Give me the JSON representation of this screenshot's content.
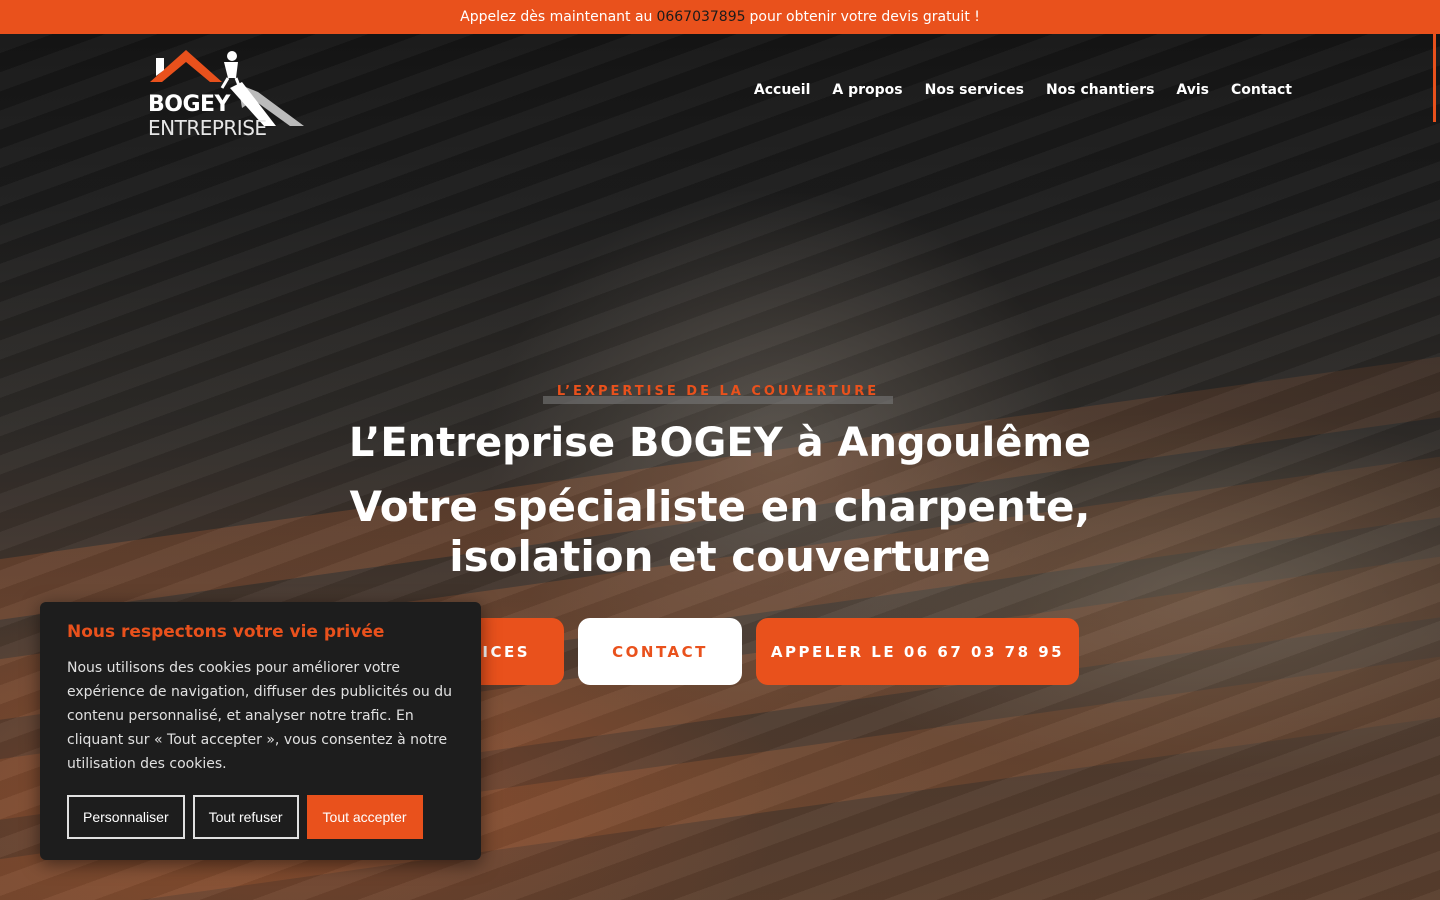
{
  "topbar": {
    "prefix": "Appelez dès maintenant au",
    "phone": "0667037895",
    "suffix": "pour obtenir votre devis gratuit !"
  },
  "logo": {
    "line1": "BOGEY",
    "line2": "ENTREPRISE"
  },
  "nav": {
    "items": [
      {
        "label": "Accueil"
      },
      {
        "label": "A propos"
      },
      {
        "label": "Nos services"
      },
      {
        "label": "Nos chantiers"
      },
      {
        "label": "Avis"
      },
      {
        "label": "Contact"
      }
    ]
  },
  "hero": {
    "eyebrow": "L’EXPERTISE DE LA COUVERTURE",
    "title": "L’Entreprise BOGEY à Angoulême",
    "subtitle": "Votre spécialiste en charpente, isolation et couverture",
    "buttons": {
      "services": "VICES",
      "contact": "CONTACT",
      "call": "APPELER LE 06 67 03 78 95"
    }
  },
  "cookie": {
    "title": "Nous respectons votre vie privée",
    "text": "Nous utilisons des cookies pour améliorer votre expérience de navigation, diffuser des publicités ou du contenu personnalisé, et analyser notre trafic. En cliquant sur « Tout accepter », vous consentez à notre utilisation des cookies.",
    "customize": "Personnaliser",
    "reject": "Tout refuser",
    "accept": "Tout accepter"
  },
  "colors": {
    "accent": "#e9511c",
    "dark": "#1d1d1d"
  }
}
